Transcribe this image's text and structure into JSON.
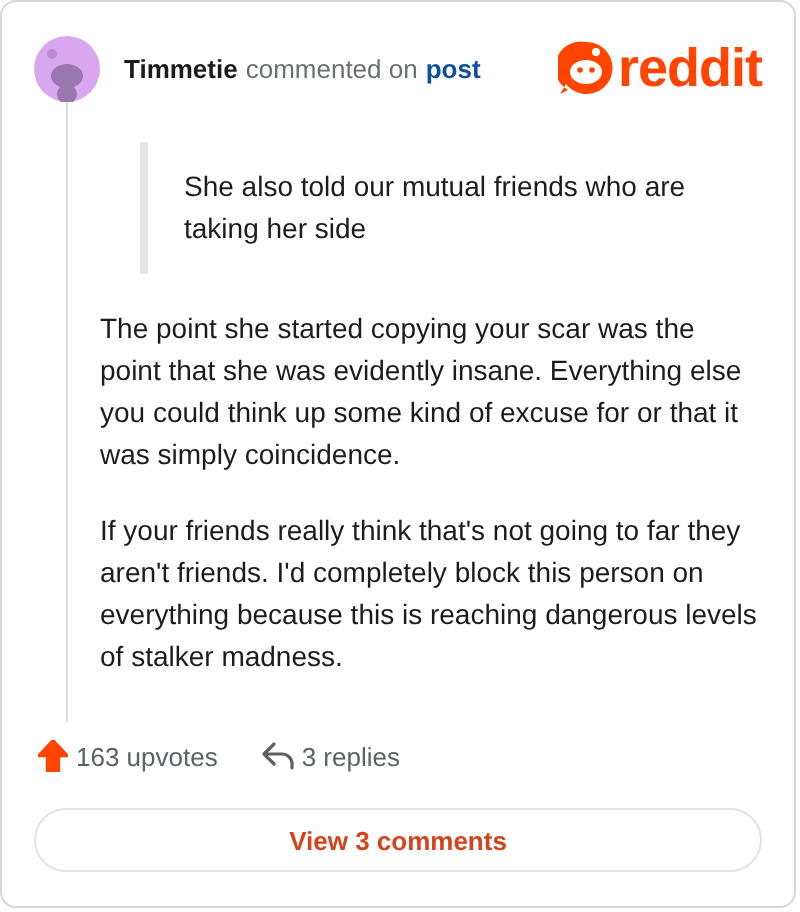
{
  "header": {
    "username": "Timmetie",
    "action": "commented on",
    "target": "post",
    "logo_text": "reddit"
  },
  "quote": "She also told our mutual friends who are taking her side",
  "paragraphs": [
    "The point she started copying your scar was the point that she was evidently insane. Everything else you could think up some kind of excuse for or that it was simply coincidence.",
    "If your friends really think that's not going to far they aren't friends. I'd completely block this person on everything because this is reaching dangerous levels of stalker madness."
  ],
  "footer": {
    "upvotes": "163 upvotes",
    "upvoted": true,
    "replies": "3 replies"
  },
  "button": "View 3 comments"
}
